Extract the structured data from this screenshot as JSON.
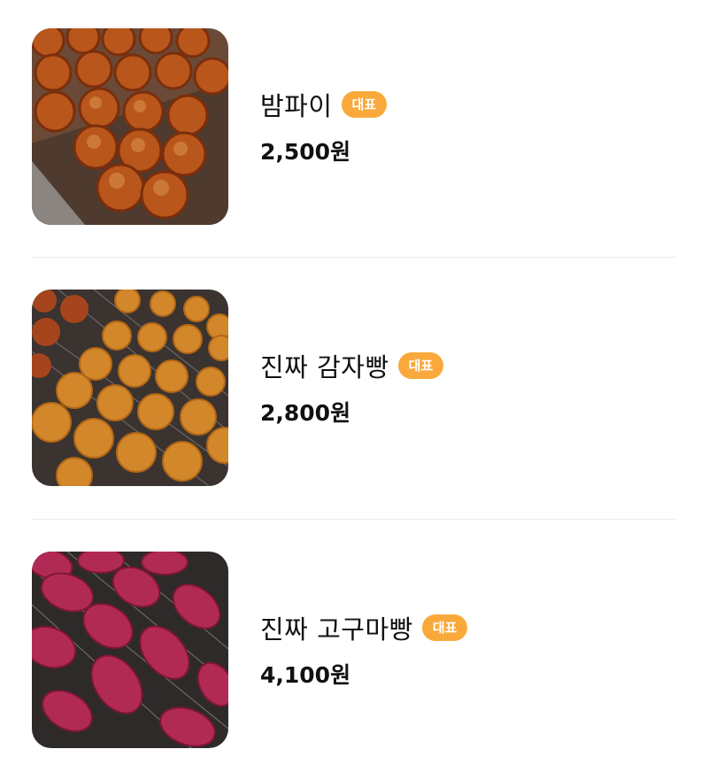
{
  "menu": {
    "items": [
      {
        "name": "밤파이",
        "badge": "대표",
        "price": "2,500원",
        "image": "chestnut-pie-photo",
        "tone": "#b9561c"
      },
      {
        "name": "진짜 감자빵",
        "badge": "대표",
        "price": "2,800원",
        "image": "potato-bread-photo",
        "tone": "#d2872b"
      },
      {
        "name": "진짜 고구마빵",
        "badge": "대표",
        "price": "4,100원",
        "image": "sweet-potato-bread-photo",
        "tone": "#b12a55"
      }
    ]
  },
  "colors": {
    "badge": "#f9a93b",
    "divider": "#ececec",
    "text": "#111111"
  }
}
